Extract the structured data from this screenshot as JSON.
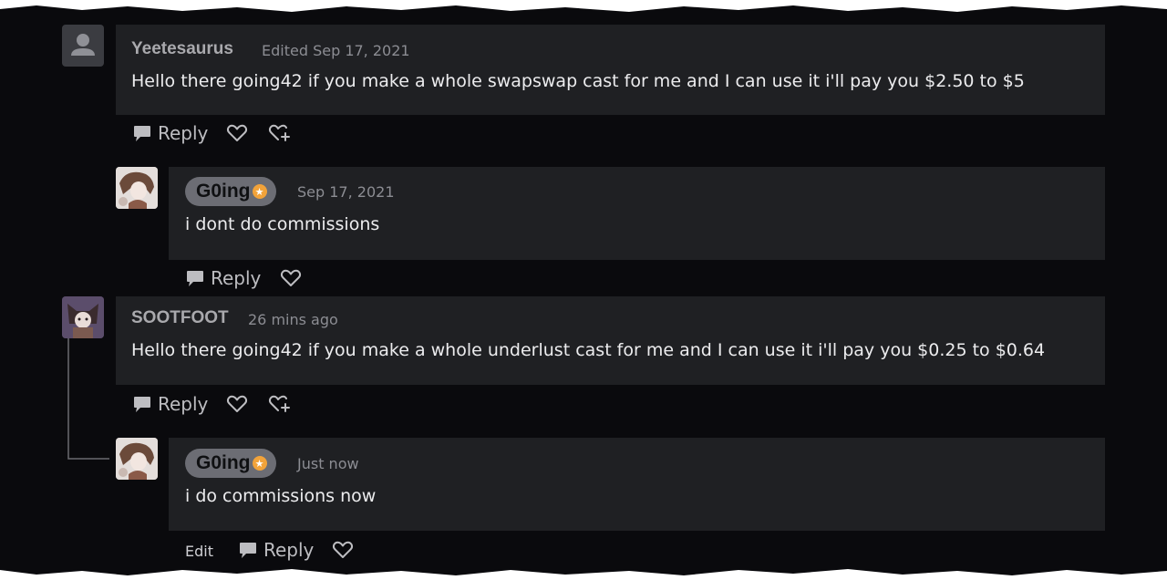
{
  "comments": [
    {
      "username": "Yeetesaurus",
      "timestamp": "Edited Sep 17, 2021",
      "text": "Hello there going42 if you make a whole swapswap cast for me and I can use it i'll pay you $2.50 to $5",
      "reply_label": "Reply"
    },
    {
      "username": "G0ing",
      "timestamp": "Sep 17, 2021",
      "text": "i dont do commissions",
      "reply_label": "Reply"
    },
    {
      "username": "SOOTFOOT",
      "timestamp": "26 mins ago",
      "text": "Hello there going42 if you make a whole underlust cast for me and I can use it i'll pay you $0.25 to $0.64",
      "reply_label": "Reply"
    },
    {
      "username": "G0ing",
      "timestamp": "Just now",
      "text": "i do commissions now",
      "reply_label": "Reply",
      "edit_label": "Edit"
    }
  ],
  "colors": {
    "page_bg": "#0a0a0d",
    "bubble_bg": "#1f2023",
    "badge": "#f2a33a",
    "pill": "#6c6d74"
  }
}
